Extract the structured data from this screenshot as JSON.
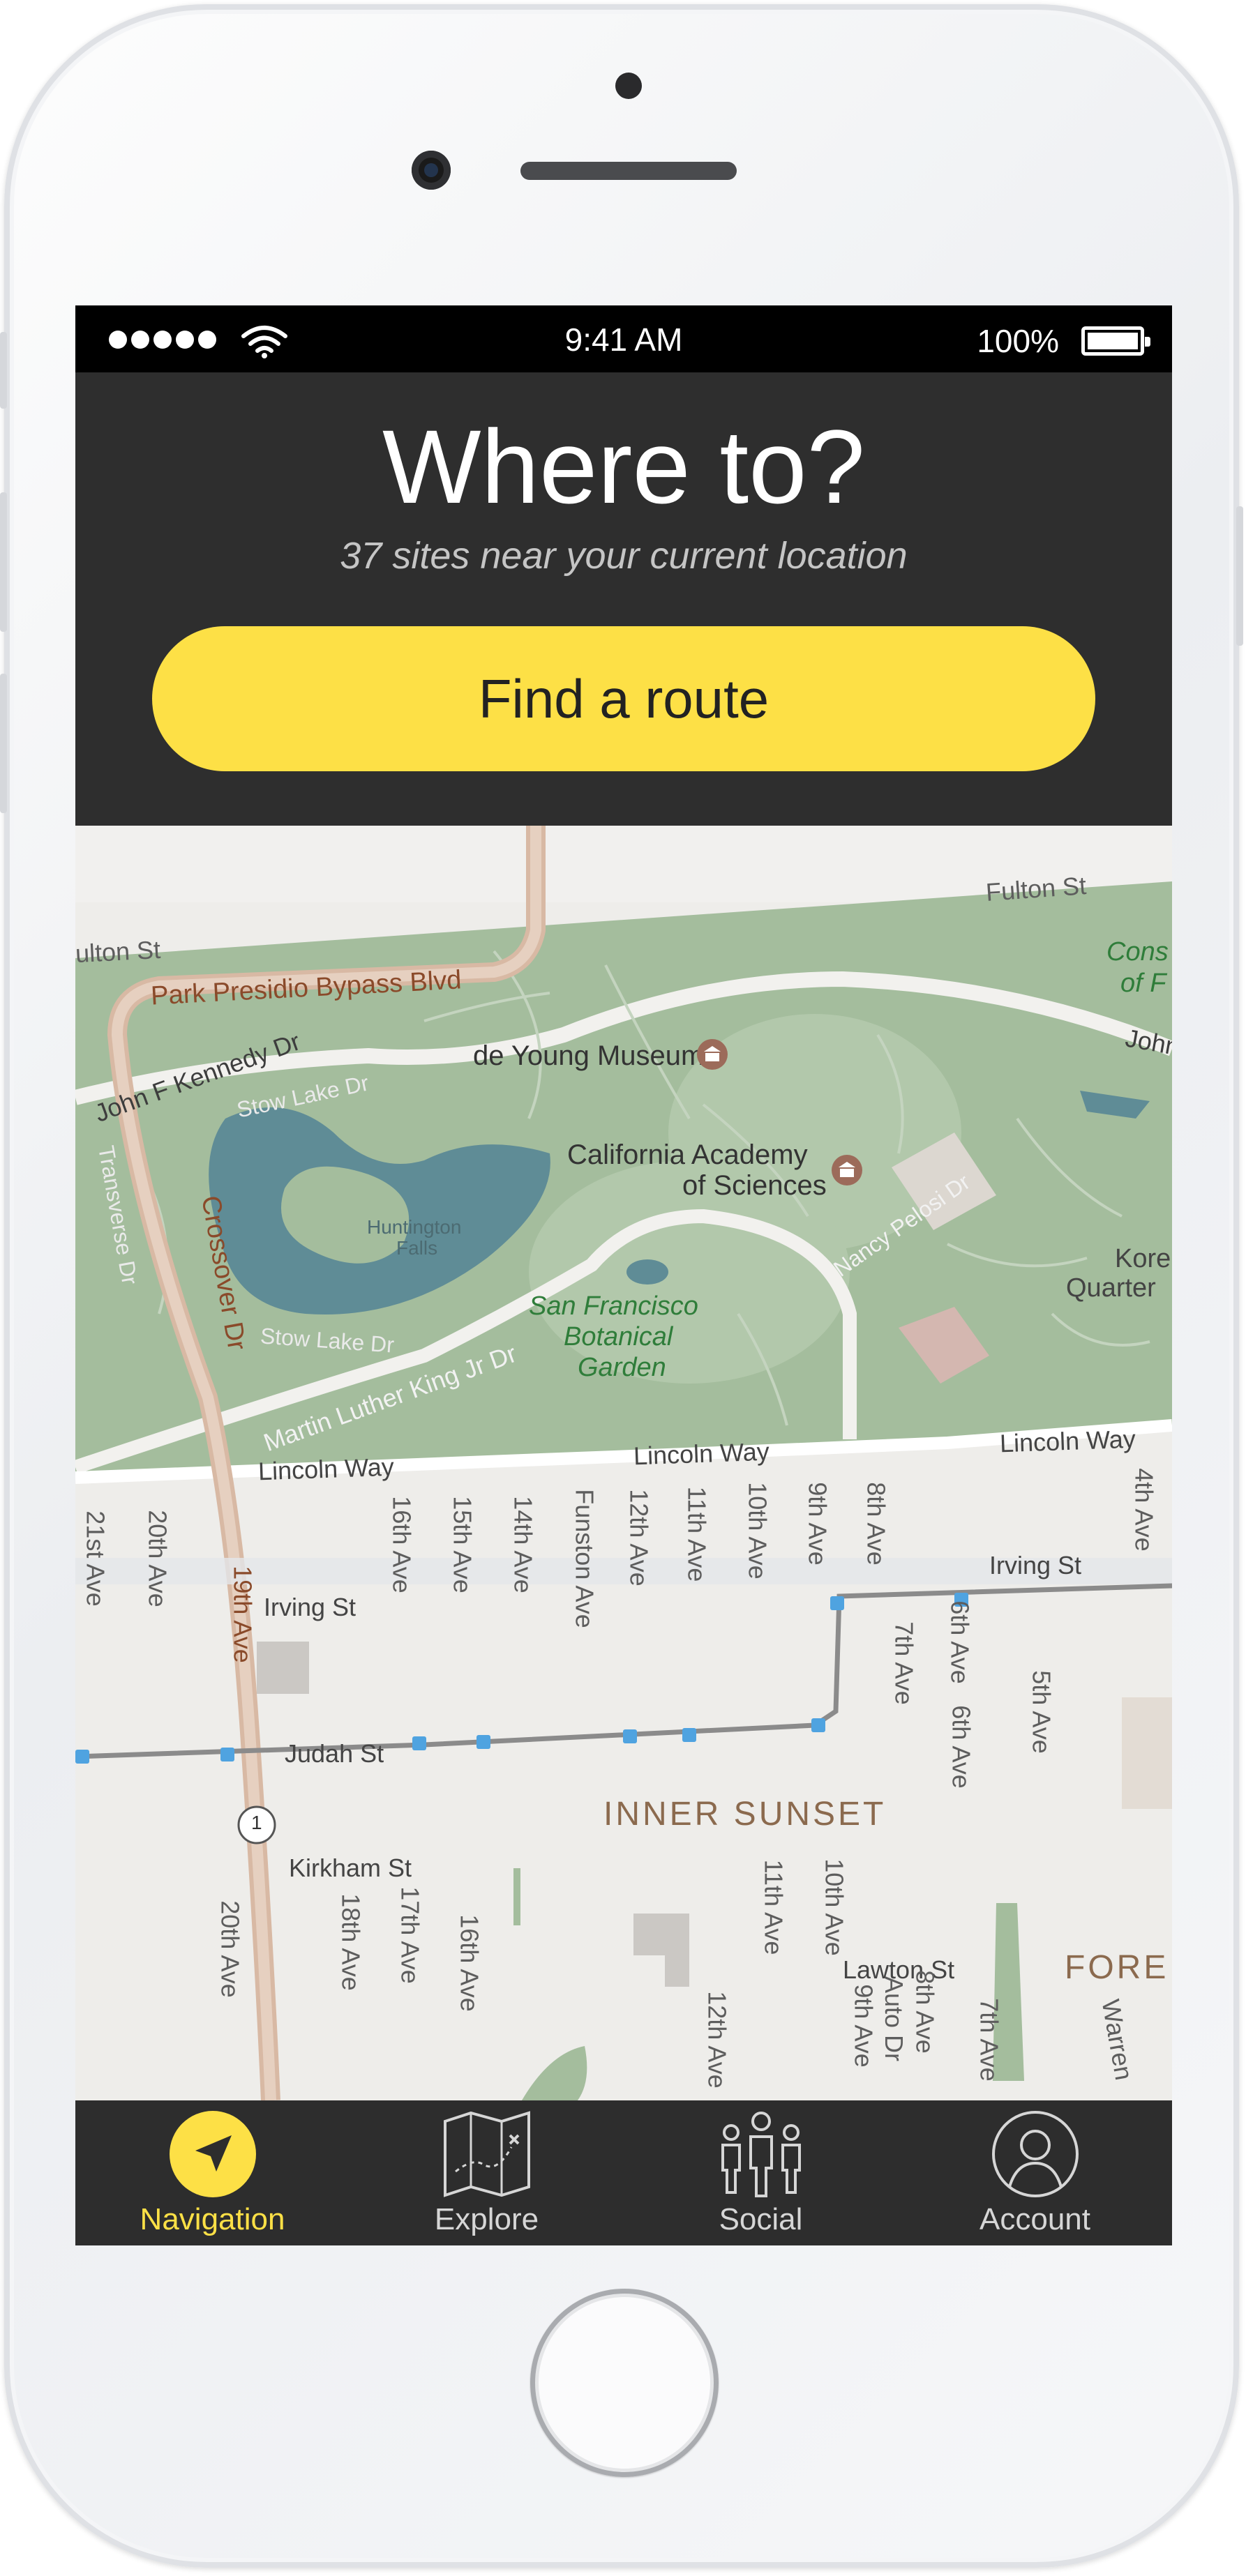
{
  "status_bar": {
    "time": "9:41 AM",
    "battery_percent": "100%",
    "signal_icon": "signal-dots-icon",
    "wifi_icon": "wifi-icon",
    "battery_icon": "battery-icon"
  },
  "header": {
    "title": "Where to?",
    "subtitle": "37 sites near your current location",
    "find_route_label": "Find a route",
    "accent_color": "#fde046",
    "background_color": "#2e2e2e"
  },
  "map": {
    "park_color": "#a4bd9d",
    "water_color": "#5f8c96",
    "road_labels": {
      "fulton_st": "Fulton St",
      "fulton_st_left": "ulton St",
      "park_presidio": "Park Presidio Bypass Blvd",
      "jfk_dr": "John F Kennedy Dr",
      "jfk_dr_right": "John",
      "stow_lake_dr": "Stow Lake Dr",
      "stow_lake_dr_2": "Stow Lake Dr",
      "transverse_dr": "Transverse Dr",
      "crossover_dr": "Crossover Dr",
      "mlk_dr": "Martin Luther King Jr Dr",
      "nancy_pelosi_dr": "Nancy Pelosi Dr",
      "lincoln_way_1": "Lincoln Way",
      "lincoln_way_2": "Lincoln Way",
      "lincoln_way_3": "Lincoln Way",
      "irving_st_1": "Irving St",
      "irving_st_2": "Irving St",
      "judah_st": "Judah St",
      "kirkham_st": "Kirkham St",
      "lawton_st": "Lawton St",
      "ave_21st": "21st Ave",
      "ave_20th": "20th Ave",
      "ave_19th": "19th Ave",
      "ave_16th": "16th Ave",
      "ave_15th": "15th Ave",
      "ave_14th": "14th Ave",
      "funston_ave": "Funston Ave",
      "ave_12th": "12th Ave",
      "ave_11th": "11th Ave",
      "ave_10th": "10th Ave",
      "ave_9th": "9th Ave",
      "ave_8th": "8th Ave",
      "ave_7th": "7th Ave",
      "ave_6th_a": "6th Ave",
      "ave_6th_b": "6th Ave",
      "ave_5th": "5th Ave",
      "ave_4th": "4th Ave",
      "ave_20th_b": "20th Ave",
      "ave_18th": "18th Ave",
      "ave_17th": "17th Ave",
      "ave_16th_b": "16th Ave",
      "ave_12th_b": "12th Ave",
      "ave_11th_b": "11th Ave",
      "ave_10th_b": "10th Ave",
      "ave_9th_b": "9th Ave",
      "auto_dr": "Auto Dr",
      "ave_8th_b": "8th Ave",
      "ave_7th_b": "7th Ave",
      "warren": "Warren",
      "route_1": "1"
    },
    "place_labels": {
      "de_young": "de Young Museum",
      "cal_academy_1": "California Academy",
      "cal_academy_2": "of Sciences",
      "huntington_1": "Huntington",
      "huntington_2": "Falls",
      "botanical_1": "San Francisco",
      "botanical_2": "Botanical",
      "botanical_3": "Garden",
      "korean_1": "Kore",
      "korean_2": "Quarter",
      "cons_1": "Cons",
      "cons_2": "of F",
      "inner_sunset": "INNER SUNSET",
      "forest": "FORE"
    }
  },
  "tabs": [
    {
      "label": "Navigation",
      "icon": "navigation-arrow-icon",
      "active": true
    },
    {
      "label": "Explore",
      "icon": "treasure-map-icon",
      "active": false
    },
    {
      "label": "Social",
      "icon": "people-group-icon",
      "active": false
    },
    {
      "label": "Account",
      "icon": "user-circle-icon",
      "active": false
    }
  ]
}
